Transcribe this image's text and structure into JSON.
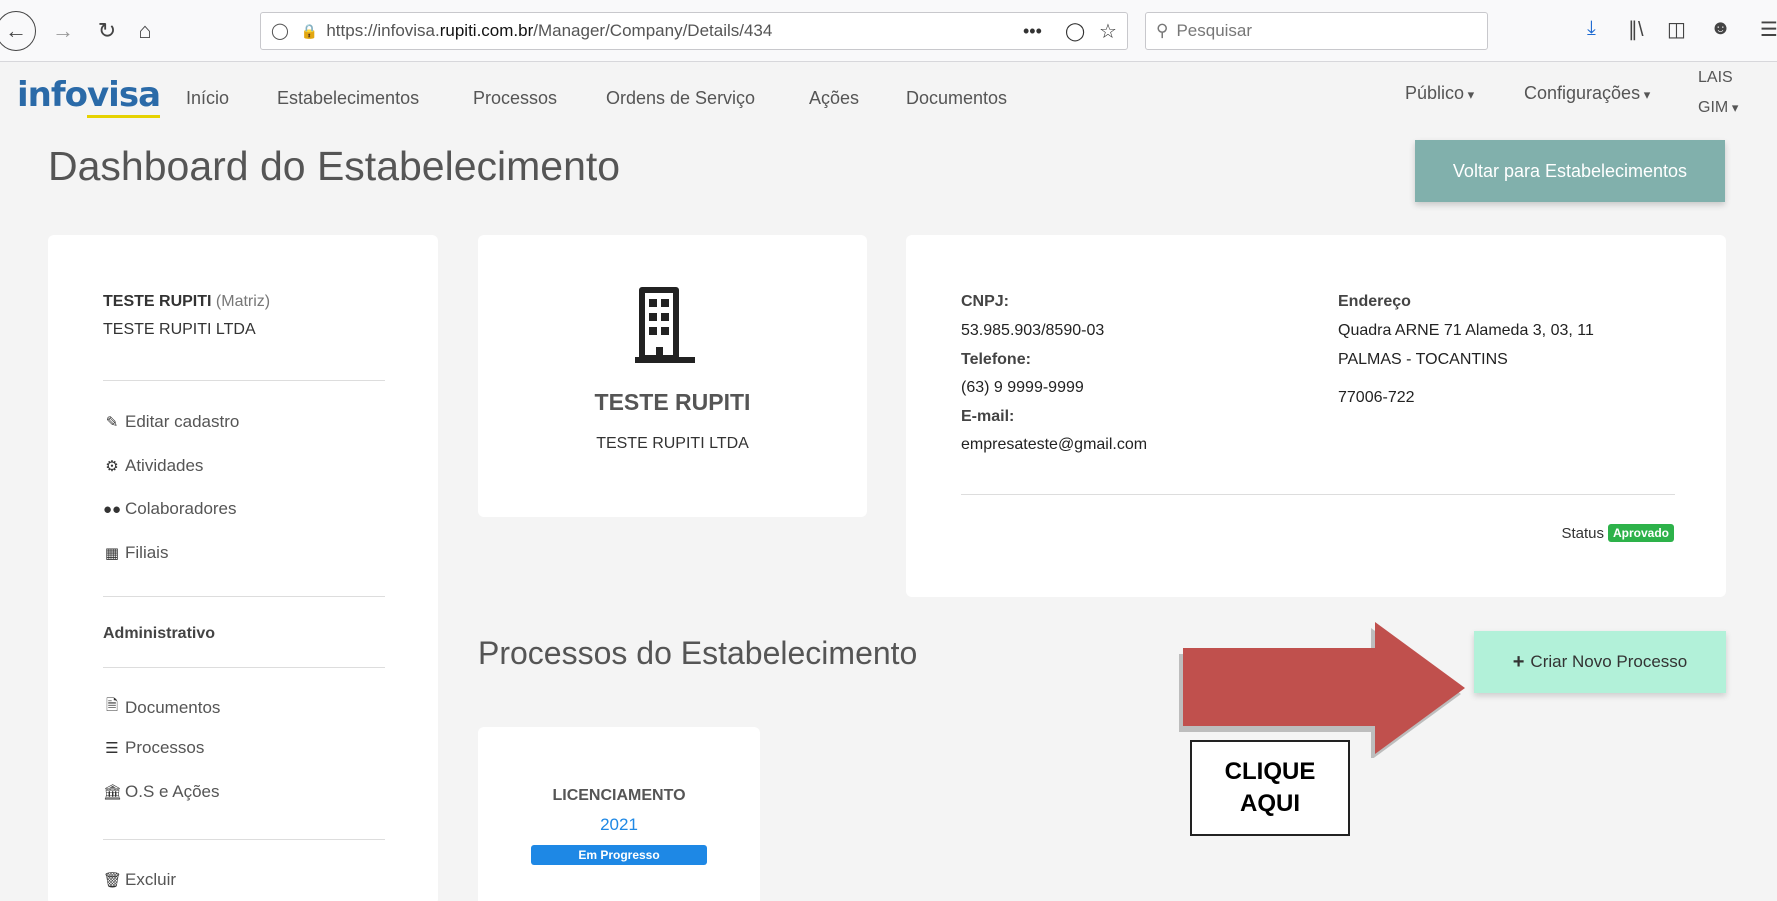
{
  "browser": {
    "url_prefix": "https://infovisa.",
    "url_host": "rupiti.com.br",
    "url_path": "/Manager/Company/Details/434",
    "search_placeholder": "Pesquisar",
    "page_actions": "•••"
  },
  "nav": {
    "logo_part1": "info",
    "logo_part2": "visa",
    "items": [
      "Início",
      "Estabelecimentos",
      "Processos",
      "Ordens de Serviço",
      "Ações",
      "Documentos"
    ],
    "publico": "Público",
    "configuracoes": "Configurações",
    "user_line1": "LAIS",
    "user_line2": "GIM"
  },
  "page": {
    "title": "Dashboard do Estabelecimento",
    "back_button": "Voltar para Estabelecimentos"
  },
  "left_panel": {
    "company_name": "TESTE RUPITI",
    "company_type": "(Matriz)",
    "legal_name": "TESTE RUPITI LTDA",
    "links": [
      "Editar cadastro",
      "Atividades",
      "Colaboradores",
      "Filiais"
    ],
    "admin_heading": "Administrativo",
    "admin_links": [
      "Documentos",
      "Processos",
      "O.S e Ações"
    ],
    "delete_link": "Excluir"
  },
  "company_card": {
    "name": "TESTE RUPITI",
    "legal_name": "TESTE RUPITI LTDA"
  },
  "info_card": {
    "cnpj_label": "CNPJ:",
    "cnpj": "53.985.903/8590-03",
    "phone_label": "Telefone:",
    "phone": "(63) 9 9999-9999",
    "email_label": "E-mail:",
    "email": "empresateste@gmail.com",
    "address_label": "Endereço",
    "address_line1": "Quadra ARNE 71 Alameda 3, 03, 11",
    "address_line2": "PALMAS - TOCANTINS",
    "zip": "77006-722",
    "status_label": "Status",
    "status_value": "Aprovado"
  },
  "processes": {
    "section_title": "Processos do Estabelecimento",
    "create_button": "Criar Novo Processo",
    "items": [
      {
        "type": "LICENCIAMENTO",
        "year": "2021",
        "status": "Em Progresso"
      }
    ]
  },
  "annotation": {
    "callout_line1": "CLIQUE",
    "callout_line2": "AQUI"
  },
  "colors": {
    "back_button_bg": "#81b0ac",
    "create_button_bg": "#b2f1d9",
    "status_approved": "#2db24a",
    "status_progress": "#1e88e5",
    "arrow_fill": "#c0504d",
    "link_blue": "#1e88e5"
  }
}
